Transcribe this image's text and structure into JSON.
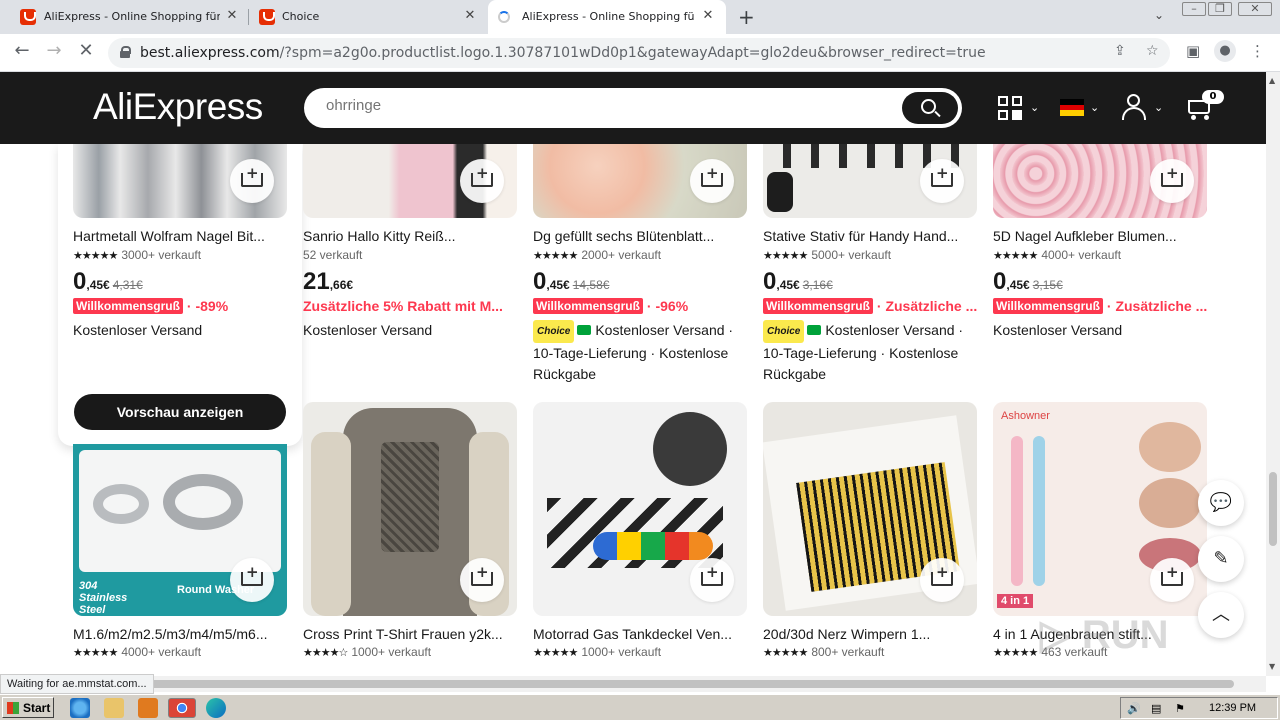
{
  "browser": {
    "tabs": [
      {
        "title": "AliExpress - Online Shopping für Elek"
      },
      {
        "title": "Choice"
      },
      {
        "title": "AliExpress - Online Shopping für Elek"
      }
    ],
    "url_host": "best.aliexpress.com",
    "url_path": "/?spm=a2g0o.productlist.logo.1.30787101wDd0p1&gatewayAdapt=glo2deu&browser_redirect=true",
    "status_text": "Waiting for ae.mmstat.com..."
  },
  "header": {
    "logo": "AliExpress",
    "search_placeholder": "ohrringe",
    "cart_count": "0"
  },
  "row1": [
    {
      "title": "Hartmetall Wolfram Nagel Bit...",
      "sold": "3000+ verkauft",
      "price_int": "0",
      "price_dec": ",45€",
      "old_price": "4,31€",
      "badge": "Willkommensgruß",
      "promo": "· -89%",
      "shipping": "Kostenloser Versand",
      "choice": false,
      "image_color": "#cfd3d6"
    },
    {
      "title": "Sanrio Hallo Kitty Reiß...",
      "sold": "52 verkauft",
      "price_int": "21",
      "price_dec": ",66€",
      "old_price": "",
      "badge": "",
      "promo": "Zusätzliche 5% Rabatt mit M...",
      "shipping": "Kostenloser Versand",
      "choice": false,
      "image_color": "#e8e2dc"
    },
    {
      "title": "Dg gefüllt sechs Blütenblatt...",
      "sold": "2000+ verkauft",
      "price_int": "0",
      "price_dec": ",45€",
      "old_price": "14,58€",
      "badge": "Willkommensgruß",
      "promo": "· -96%",
      "shipping": "Kostenloser Versand · 10-Tage-Lieferung · Kostenlose Rückgabe",
      "choice": true,
      "choice_label": "Choice",
      "image_color": "#f1c7b4"
    },
    {
      "title": "Stative Stativ für Handy Hand...",
      "sold": "5000+ verkauft",
      "price_int": "0",
      "price_dec": ",45€",
      "old_price": "3,16€",
      "badge": "Willkommensgruß",
      "promo": "· Zusätzliche ...",
      "shipping": "Kostenloser Versand · 10-Tage-Lieferung · Kostenlose Rückgabe",
      "choice": true,
      "choice_label": "Choice",
      "image_color": "#ecebe8"
    },
    {
      "title": "5D Nagel Aufkleber Blumen...",
      "sold": "4000+ verkauft",
      "price_int": "0",
      "price_dec": ",45€",
      "old_price": "3,15€",
      "badge": "Willkommensgruß",
      "promo": "· Zusätzliche ...",
      "shipping": "Kostenloser Versand",
      "choice": false,
      "image_color": "#f3c6cf"
    }
  ],
  "preview_button": "Vorschau anzeigen",
  "row2": [
    {
      "title": "M1.6/m2/m2.5/m3/m4/m5/m6...",
      "sold": "4000+ verkauft",
      "image_color": "#1f9aa0",
      "img_text": "304 Stainless Steel",
      "img_text2": "Round Washer"
    },
    {
      "title": "Cross Print T-Shirt Frauen y2k...",
      "sold": "1000+ verkauft",
      "image_color": "#7d776e"
    },
    {
      "title": "Motorrad Gas Tankdeckel Ven...",
      "sold": "1000+ verkauft",
      "image_color": "#f2f2f2"
    },
    {
      "title": "20d/30d Nerz Wimpern 1...",
      "sold": "800+ verkauft",
      "image_color": "#e9e7e2"
    },
    {
      "title": "4 in 1 Augenbrauen stift...",
      "sold": "463 verkauft",
      "image_color": "#f6ece8",
      "img_text": "Ashowner",
      "img_text2": "4 in 1"
    }
  ],
  "taskbar": {
    "start": "Start",
    "clock": "12:39 PM"
  },
  "colors": {
    "brand_red": "#fd384f",
    "header_bg": "#1a1a1a",
    "choice_yellow": "#fbe94d"
  }
}
